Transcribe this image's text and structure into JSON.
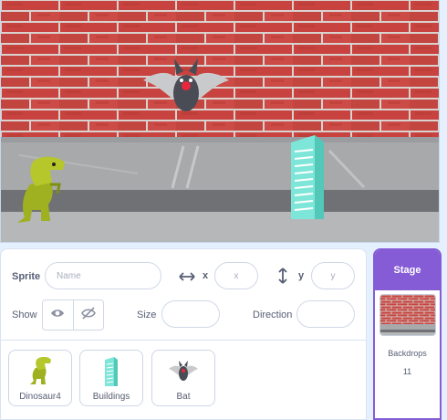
{
  "sprite_info": {
    "sprite_label": "Sprite",
    "name_placeholder": "Name",
    "x_label": "x",
    "x_placeholder": "x",
    "y_label": "y",
    "y_placeholder": "y",
    "show_label": "Show",
    "size_label": "Size",
    "direction_label": "Direction"
  },
  "sprites": [
    {
      "name": "Dinosaur4",
      "icon": "dinosaur-icon"
    },
    {
      "name": "Buildings",
      "icon": "building-icon"
    },
    {
      "name": "Bat",
      "icon": "bat-icon"
    }
  ],
  "stage_panel": {
    "title": "Stage",
    "backdrops_label": "Backdrops",
    "backdrops_count": "11"
  },
  "colors": {
    "accent": "#855cd6",
    "brick": "#c94a45",
    "panel_bg": "#e5f0ff"
  }
}
